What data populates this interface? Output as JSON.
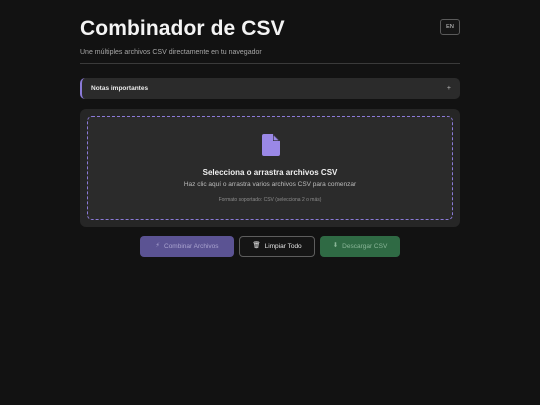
{
  "header": {
    "title": "Combinador de CSV",
    "subtitle": "Une múltiples archivos CSV directamente en tu navegador",
    "lang_button": "EN"
  },
  "notes": {
    "label": "Notas importantes",
    "toggle": "+"
  },
  "dropzone": {
    "icon": "file-icon",
    "title": "Selecciona o arrastra archivos CSV",
    "subtitle": "Haz clic aquí o arrastra varios archivos CSV para comenzar",
    "note": "Formato soportado: CSV (selecciona 2 o más)"
  },
  "actions": {
    "combine": {
      "icon": "⚡",
      "label": "Combinar Archivos"
    },
    "clear": {
      "icon": "🗑",
      "label": "Limpiar Todo"
    },
    "download": {
      "icon": "⬇",
      "label": "Descargar CSV"
    }
  },
  "colors": {
    "background": "#121212",
    "accent": "#8b7ad8",
    "combine_button": "#5b5393",
    "download_button": "#2f6a44"
  }
}
